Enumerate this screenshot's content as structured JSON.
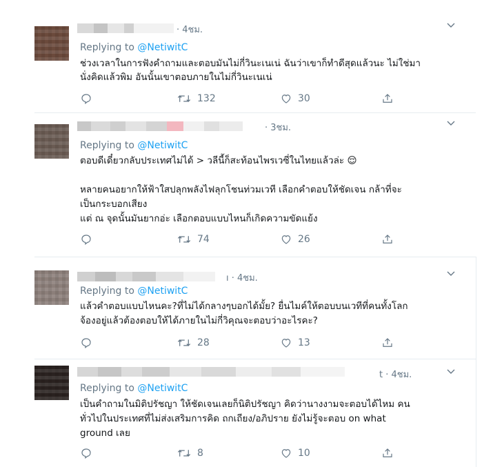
{
  "tweets": [
    {
      "time": "· 4ชม.",
      "replying_prefix": "Replying to",
      "replying_handle": "@NetiwitC",
      "lines": [
        "ช่วงเวลาในการฟังคำถามและตอบมันไม่กี่วินะเนเน่ ฉันว่าเขาก็ทำดีสุดแล้วนะ ไม่ใช่มา",
        "นั่งคิดแล้วพิม อันนั้นเขาตอบภายในไม่กี่วินะเนเน่"
      ],
      "retweets": "132",
      "likes": "30"
    },
    {
      "time": "· 3ชม.",
      "replying_prefix": "Replying to",
      "replying_handle": "@NetiwitC",
      "lines": [
        "ตอบดีเดี๋ยวกลับประเทศไม่ได้ > วลีนี้ก็สะท้อนไพรเวซี่ในไทยแล้วล่ะ 😌",
        "",
        "หลายคนอยากให้ฟ้าใสปลุกพลังไฟลุกโชนท่วมเวที เลือกคำตอบให้ชัดเจน กล้าที่จะ",
        "เป็นกระบอกเสียง",
        "แต่ ณ จุดนั้นมันยากอ่ะ เลือกตอบแบบไหนก็เกิดความขัดแย้ง"
      ],
      "retweets": "74",
      "likes": "26"
    },
    {
      "time": "ı · 4ชม.",
      "replying_prefix": "Replying to",
      "replying_handle": "@NetiwitC",
      "lines": [
        "แล้วคำตอบแบบไหนคะ?ที่ไม่ได้กลางๆบอกได้มั้ย? ยื่นไมค์ให้ตอบบนเวทีที่คนทั้งโลก",
        "จ้องอยู่แล้วต้องตอบให้ได้ภายในไม่กี่วิคุณจะตอบว่าอะไรคะ?"
      ],
      "retweets": "28",
      "likes": "13"
    },
    {
      "time": "t · 4ชม.",
      "replying_prefix": "Replying to",
      "replying_handle": "@NetiwitC",
      "lines": [
        "เป็นคำถามในมิติปรัชญา ให้ชัดเจนเลยก็นิติปรัชญา คิดว่านางงามจะตอบได้ไหม คน",
        "ทั่วไปในประเทศที่ไม่ส่งเสริมการคิด ถกเถียง/อภิปราย ยังไม่รู้จะตอบ on what",
        "ground เลย"
      ],
      "retweets": "8",
      "likes": "10"
    }
  ],
  "icons": {
    "reply": "reply-icon",
    "retweet": "retweet-icon",
    "like": "heart-icon",
    "share": "share-icon",
    "more": "chevron-down-icon"
  },
  "colors": {
    "accent": "#1da1f2",
    "muted": "#657786",
    "text": "#14171a",
    "divider": "#e6ecf0"
  }
}
